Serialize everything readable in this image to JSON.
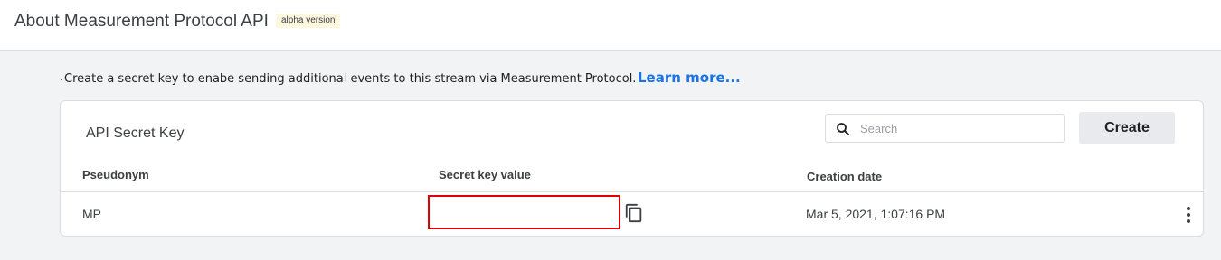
{
  "header": {
    "title": "About Measurement Protocol API",
    "badge": "alpha version"
  },
  "intro": {
    "text": "Create a secret key to enabe sending additional events to this stream via Measurement Protocol.",
    "learn_more": "Learn more..."
  },
  "card": {
    "title": "API Secret Key",
    "search": {
      "placeholder": "Search",
      "value": "",
      "icon": "search-icon"
    },
    "create_label": "Create",
    "columns": [
      "Pseudonym",
      "Secret key value",
      "Creation date"
    ],
    "rows": [
      {
        "pseudonym": "MP",
        "secret_key_value": "",
        "creation_date": "Mar 5, 2021, 1:07:16 PM",
        "copy_icon": "copy-icon",
        "more_icon": "more-vert-icon"
      }
    ]
  },
  "colors": {
    "accent": "#1a73e8",
    "highlight_border": "#e00000",
    "badge_bg": "#fef7e0",
    "page_bg": "#f1f3f4"
  }
}
